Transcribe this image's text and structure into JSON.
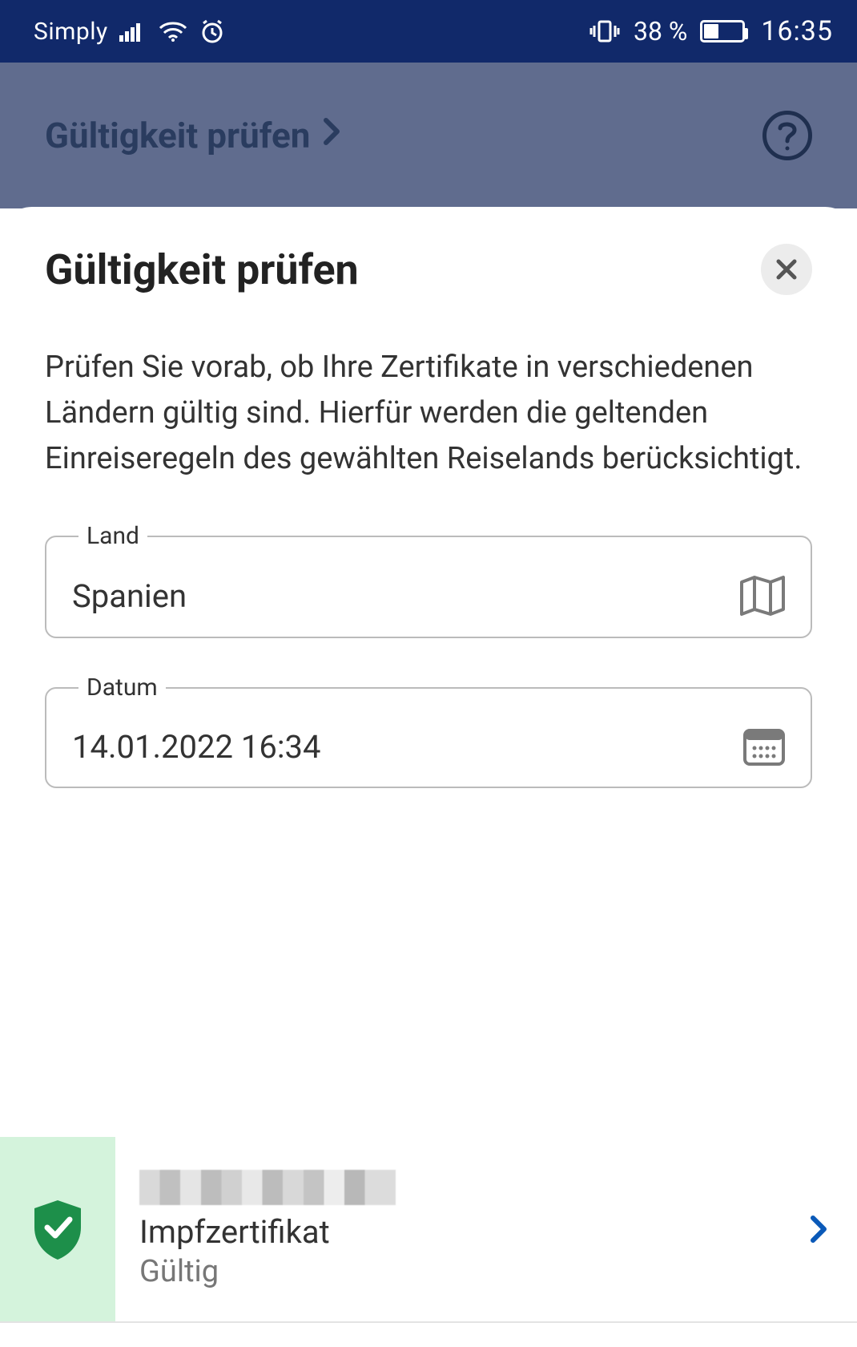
{
  "status_bar": {
    "carrier": "Simply",
    "battery_percent": "38 %",
    "time": "16:35"
  },
  "back_header": {
    "title": "Gültigkeit prüfen"
  },
  "sheet": {
    "title": "Gültigkeit prüfen",
    "description": "Prüfen Sie vorab, ob Ihre Zertifikate in verschiedenen Ländern gültig sind. Hierfür werden die geltenden Einreiseregeln des gewählten Reiselands berücksichtigt.",
    "fields": {
      "country": {
        "label": "Land",
        "value": "Spanien"
      },
      "date": {
        "label": "Datum",
        "value": "14.01.2022 16:34"
      }
    },
    "result": {
      "certificate_type": "Impfzertifikat",
      "status": "Gültig"
    }
  }
}
